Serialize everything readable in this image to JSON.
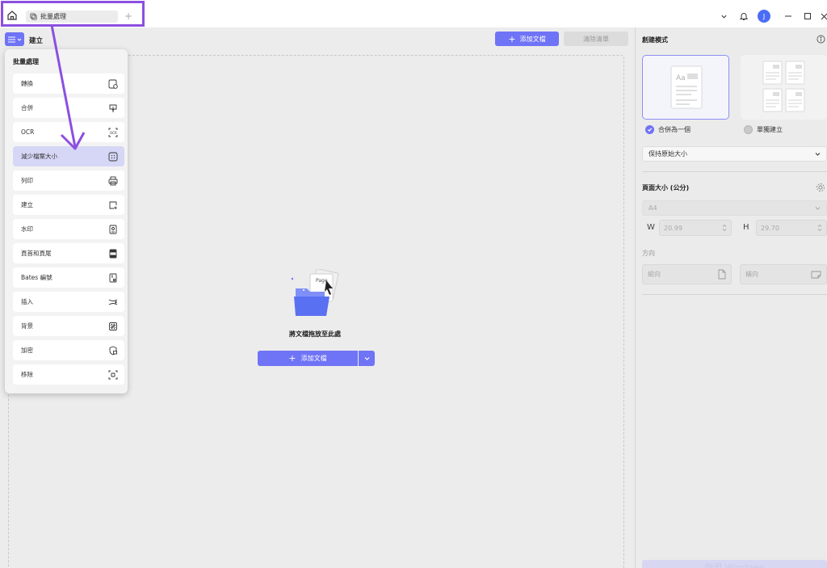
{
  "tabs": [
    {
      "label": "批量處理"
    }
  ],
  "toolbar": {
    "mode_label": "建立",
    "add_label": "添加文檔",
    "clear_label": "清除清單"
  },
  "dropzone": {
    "text": "將文檔拖放至此處",
    "add_label": "添加文檔"
  },
  "popup": {
    "title": "批量處理",
    "items": [
      {
        "label": "轉換",
        "icon": "convert-icon"
      },
      {
        "label": "合併",
        "icon": "merge-icon"
      },
      {
        "label": "OCR",
        "icon": "ocr-icon"
      },
      {
        "label": "減少檔案大小",
        "icon": "compress-icon",
        "active": true
      },
      {
        "label": "列印",
        "icon": "print-icon"
      },
      {
        "label": "建立",
        "icon": "create-icon"
      },
      {
        "label": "水印",
        "icon": "watermark-icon"
      },
      {
        "label": "頁首和頁尾",
        "icon": "header-footer-icon"
      },
      {
        "label": "Bates 編號",
        "icon": "bates-icon"
      },
      {
        "label": "插入",
        "icon": "insert-icon"
      },
      {
        "label": "背景",
        "icon": "background-icon"
      },
      {
        "label": "加密",
        "icon": "encrypt-icon"
      },
      {
        "label": "移除",
        "icon": "remove-icon"
      }
    ]
  },
  "settings": {
    "title": "創建模式",
    "mode_merge": "合併為一個",
    "mode_separate": "單獨建立",
    "size_option": "保持原始大小",
    "page_size_title": "頁面大小 (公分)",
    "paper": "A4",
    "w_label": "W",
    "w_value": "20.99",
    "h_label": "H",
    "h_value": "29.70",
    "direction_label": "方向",
    "portrait": "縱向",
    "landscape": "橫向",
    "apply_label": "啟用 Windows"
  },
  "card_thumb_text": "Aa",
  "illustration_text": "Page",
  "colors": {
    "accent": "#6f73f5",
    "highlight": "#8c4fe0",
    "active_item": "#d6d6f6"
  }
}
